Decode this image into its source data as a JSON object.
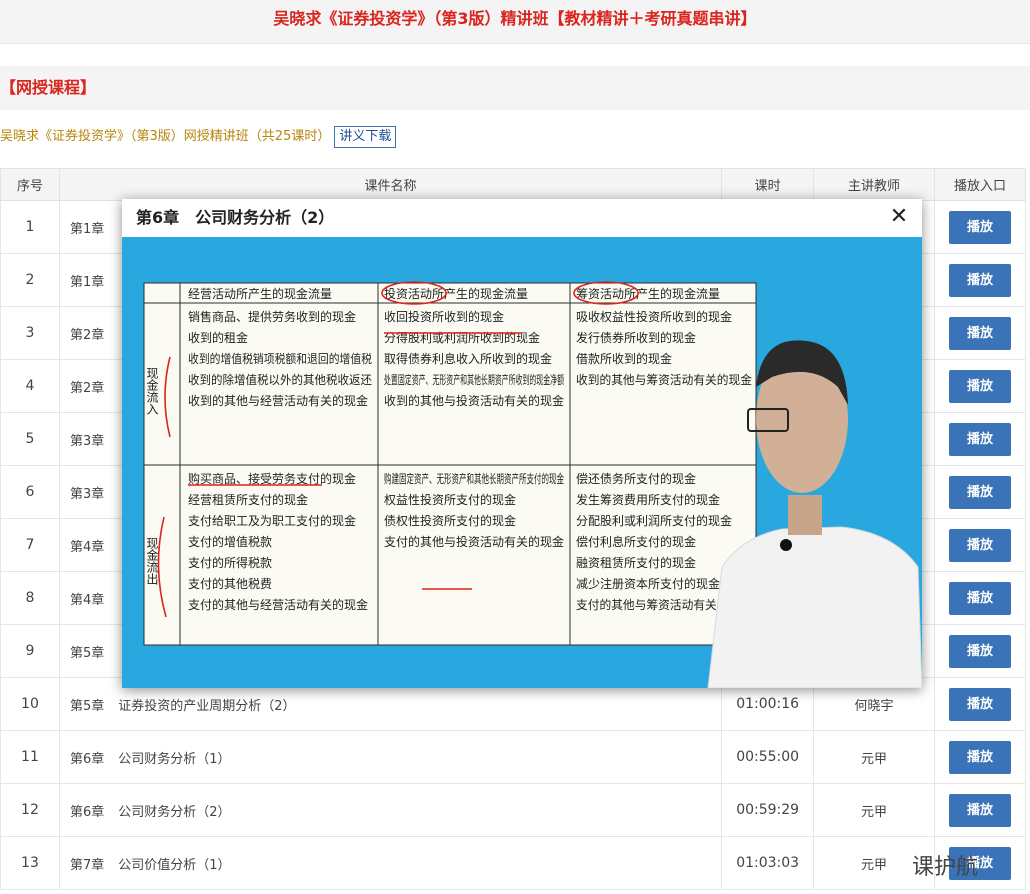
{
  "page": {
    "title": "吴晓求《证券投资学》（第3版）精讲班【教材精讲＋考研真题串讲】"
  },
  "section": {
    "title": "【网授课程】"
  },
  "course": {
    "name": "吴晓求《证券投资学》（第3版）网授精讲班（共25课时）",
    "download_label": "讲义下载"
  },
  "table": {
    "headers": [
      "序号",
      "课件名称",
      "课时",
      "主讲教师",
      "播放入口"
    ],
    "play_label": "播放",
    "rows": [
      {
        "idx": "1",
        "chapter": "第1章",
        "title": "",
        "time": "",
        "teacher": ""
      },
      {
        "idx": "2",
        "chapter": "第1章",
        "title": "",
        "time": "",
        "teacher": ""
      },
      {
        "idx": "3",
        "chapter": "第2章",
        "title": "",
        "time": "",
        "teacher": ""
      },
      {
        "idx": "4",
        "chapter": "第2章",
        "title": "",
        "time": "",
        "teacher": ""
      },
      {
        "idx": "5",
        "chapter": "第3章",
        "title": "",
        "time": "",
        "teacher": ""
      },
      {
        "idx": "6",
        "chapter": "第3章",
        "title": "",
        "time": "",
        "teacher": ""
      },
      {
        "idx": "7",
        "chapter": "第4章",
        "title": "",
        "time": "",
        "teacher": ""
      },
      {
        "idx": "8",
        "chapter": "第4章",
        "title": "",
        "time": "",
        "teacher": ""
      },
      {
        "idx": "9",
        "chapter": "第5章",
        "title": "",
        "time": "",
        "teacher": ""
      },
      {
        "idx": "10",
        "chapter": "第5章",
        "title": "证券投资的产业周期分析（2）",
        "time": "01:00:16",
        "teacher": "何晓宇"
      },
      {
        "idx": "11",
        "chapter": "第6章",
        "title": "公司财务分析（1）",
        "time": "00:55:00",
        "teacher": "元甲"
      },
      {
        "idx": "12",
        "chapter": "第6章",
        "title": "公司财务分析（2）",
        "time": "00:59:29",
        "teacher": "元甲"
      },
      {
        "idx": "13",
        "chapter": "第7章",
        "title": "公司价值分析（1）",
        "time": "01:03:03",
        "teacher": "元甲"
      }
    ]
  },
  "modal": {
    "title": "第6章　公司财务分析（2）",
    "close_glyph": "✕"
  },
  "slide": {
    "headers": [
      "经营活动所产生的现金流量",
      "投资活动所产生的现金流量",
      "筹资活动所产生的现金流量"
    ],
    "row_labels": [
      "现金流入",
      "现金流出"
    ],
    "inflow": [
      [
        "销售商品、提供劳务收到的现金",
        "收到的租金",
        "收到的增值税销项税额和退回的增值税",
        "收到的除增值税以外的其他税收返还",
        "收到的其他与经营活动有关的现金"
      ],
      [
        "收回投资所收到的现金",
        "分得股利或利润所收到的现金",
        "取得债券利息收入所收到的现金",
        "处置固定资产、无形资产和其他长期资产所收到的现金净额",
        "收到的其他与投资活动有关的现金"
      ],
      [
        "吸收权益性投资所收到的现金",
        "发行债券所收到的现金",
        "借款所收到的现金",
        "收到的其他与筹资活动有关的现金"
      ]
    ],
    "outflow": [
      [
        "购买商品、接受劳务支付的现金",
        "经营租赁所支付的现金",
        "支付给职工及为职工支付的现金",
        "支付的增值税款",
        "支付的所得税款",
        "支付的其他税费",
        "支付的其他与经营活动有关的现金"
      ],
      [
        "购建固定资产、无形资产和其他长期资产所支付的现金",
        "权益性投资所支付的现金",
        "债权性投资所支付的现金",
        "支付的其他与投资活动有关的现金"
      ],
      [
        "偿还债务所支付的现金",
        "发生筹资费用所支付的现金",
        "分配股利或利润所支付的现金",
        "偿付利息所支付的现金",
        "融资租赁所支付的现金",
        "减少注册资本所支付的现金",
        "支付的其他与筹资活动有关的现金"
      ]
    ]
  },
  "watermark": {
    "text": "课护航"
  },
  "colors": {
    "accent_red": "#d9251d",
    "button_blue": "#3a73b8",
    "video_bg": "#29a7df"
  }
}
